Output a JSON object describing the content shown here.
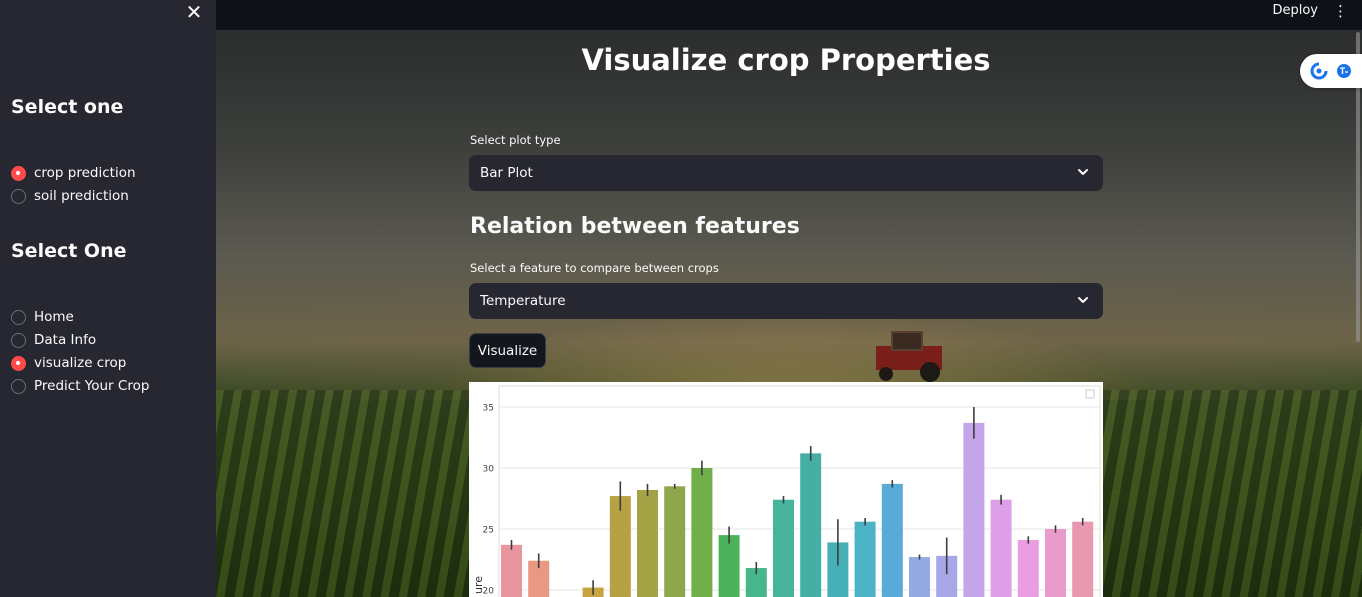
{
  "sidebar": {
    "close_label": "✕",
    "group1_title": "Select one",
    "group1_options": [
      {
        "label": "crop prediction",
        "selected": true
      },
      {
        "label": "soil prediction",
        "selected": false
      }
    ],
    "group2_title": "Select One",
    "group2_options": [
      {
        "label": "Home",
        "selected": false
      },
      {
        "label": "Data Info",
        "selected": false
      },
      {
        "label": "visualize crop",
        "selected": true
      },
      {
        "label": "Predict Your Crop",
        "selected": false
      }
    ]
  },
  "header": {
    "deploy_label": "Deploy",
    "menu_label": "⋮"
  },
  "main": {
    "title": "Visualize crop Properties",
    "plot_type_label": "Select plot type",
    "plot_type_value": "Bar Plot",
    "section_title": "Relation between features",
    "feature_label": "Select a feature to compare between crops",
    "feature_value": "Temperature",
    "visualize_button": "Visualize"
  },
  "colors": {
    "accent": "#ff4b4b",
    "sidebar_bg": "#262730",
    "app_bg": "#0e1117"
  },
  "chart_data": {
    "type": "bar",
    "ylabel": "ure",
    "yticks": [
      20,
      25,
      30,
      35
    ],
    "ylim": [
      19.5,
      36.2
    ],
    "grid": true,
    "values": [
      23.7,
      22.4,
      19.0,
      20.2,
      27.7,
      28.2,
      28.5,
      30.0,
      24.5,
      21.8,
      27.4,
      31.2,
      23.9,
      25.6,
      28.7,
      22.7,
      22.8,
      33.7,
      27.4,
      24.1,
      25.0,
      25.6
    ],
    "errors": [
      0.4,
      0.6,
      0.0,
      0.6,
      1.2,
      0.5,
      0.2,
      0.6,
      0.7,
      0.5,
      0.3,
      0.6,
      1.9,
      0.3,
      0.3,
      0.2,
      1.5,
      1.3,
      0.4,
      0.3,
      0.3,
      0.3
    ],
    "colors": [
      "#e8959f",
      "#e99884",
      "#d9a05b",
      "#c9a241",
      "#b6a244",
      "#a4a446",
      "#8fa74a",
      "#6fae48",
      "#4cb35c",
      "#48b58b",
      "#47b39d",
      "#45aea5",
      "#47b0b6",
      "#4bb3c5",
      "#59aad7",
      "#95a9e2",
      "#a8a6e6",
      "#c5a5ea",
      "#dfa0ea",
      "#e89ee0",
      "#e99bcc",
      "#e898b1"
    ]
  }
}
